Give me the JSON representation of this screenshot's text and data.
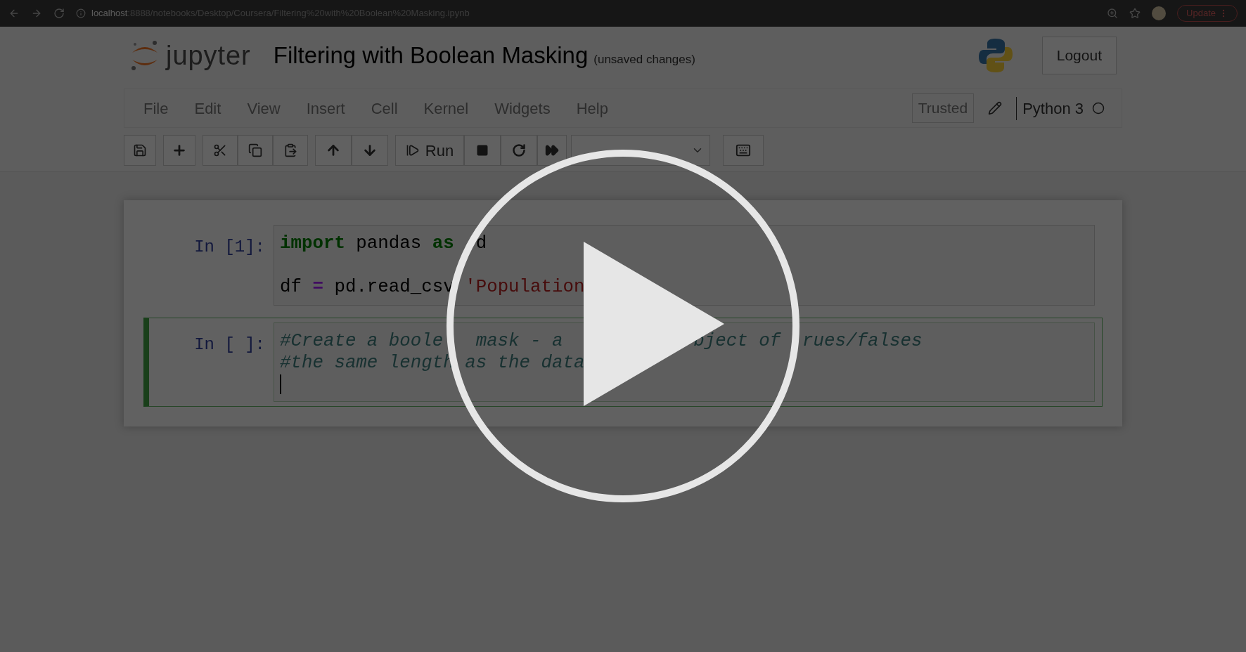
{
  "browser": {
    "url_host": "localhost",
    "url_path": ":8888/notebooks/Desktop/Coursera/Filtering%20with%20Boolean%20Masking.ipynb",
    "update_button": "Update"
  },
  "header": {
    "logo_text": "jupyter",
    "title": "Filtering with Boolean Masking",
    "status": "(unsaved changes)",
    "logout": "Logout"
  },
  "menu": [
    "File",
    "Edit",
    "View",
    "Insert",
    "Cell",
    "Kernel",
    "Widgets",
    "Help"
  ],
  "kernel": {
    "trusted": "Trusted",
    "name": "Python 3"
  },
  "toolbar": {
    "run": "Run"
  },
  "cells": [
    {
      "prompt": "In [1]:",
      "selected": false,
      "editing": false,
      "lines": [
        {
          "gap_before": false,
          "fragments": [
            {
              "tokens": [
                {
                  "kind": "keyword",
                  "text": "import"
                },
                {
                  "kind": "plain",
                  "text": " pandas "
                },
                {
                  "kind": "keyword",
                  "text": "as"
                }
              ]
            },
            {
              "tokens": [
                {
                  "kind": "plain",
                  "text": "d"
                }
              ]
            }
          ]
        },
        {
          "gap_before": true,
          "fragments": [
            {
              "tokens": [
                {
                  "kind": "plain",
                  "text": "df "
                },
                {
                  "kind": "operator",
                  "text": "="
                },
                {
                  "kind": "plain",
                  "text": " pd.read_csv"
                }
              ]
            },
            {
              "tokens": [
                {
                  "kind": "string",
                  "text": "'Population"
                }
              ]
            }
          ]
        }
      ]
    },
    {
      "prompt": "In [ ]:",
      "selected": true,
      "editing": true,
      "lines": [
        {
          "gap_before": false,
          "fragments": [
            {
              "tokens": [
                {
                  "kind": "comment",
                  "text": "#Create a boole"
                }
              ]
            },
            {
              "tokens": [
                {
                  "kind": "comment",
                  "text": "mask - a"
                }
              ]
            },
            {
              "tokens": [
                {
                  "kind": "comment",
                  "text": "bject of"
                }
              ]
            },
            {
              "tokens": [
                {
                  "kind": "comment",
                  "text": "rues/falses"
                }
              ]
            }
          ]
        },
        {
          "gap_before": false,
          "fragments": [
            {
              "tokens": [
                {
                  "kind": "comment",
                  "text": "#the same length as the data"
                }
              ]
            }
          ]
        }
      ]
    }
  ]
}
